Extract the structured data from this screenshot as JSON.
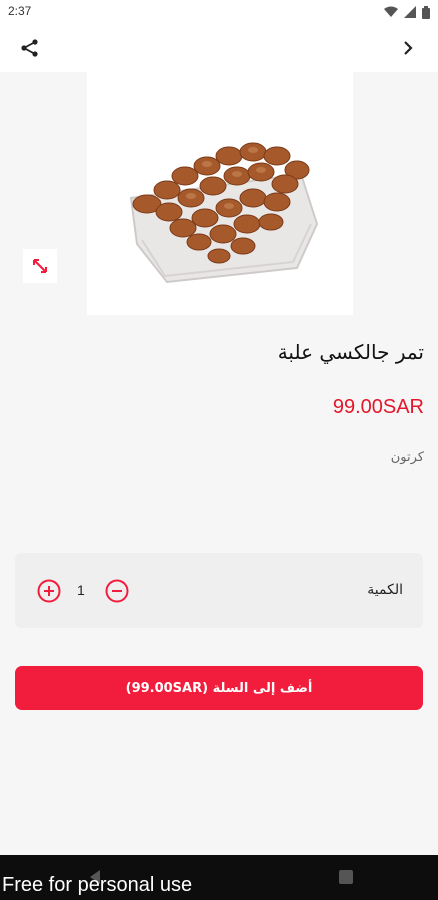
{
  "status": {
    "time": "2:37"
  },
  "product": {
    "title": "تمر جالكسي علبة",
    "price": "99.00SAR",
    "unit": "كرتون"
  },
  "quantity": {
    "label": "الكمية",
    "value": "1"
  },
  "cart": {
    "button_label": "أضف إلى السلة (99.00SAR)"
  },
  "watermark": "Free for personal use",
  "colors": {
    "accent": "#f21d3d",
    "price": "#e3162b",
    "card": "#efefef"
  },
  "icons": [
    "share-icon",
    "chevron-right-icon",
    "expand-icon",
    "plus-circle-icon",
    "minus-circle-icon"
  ]
}
